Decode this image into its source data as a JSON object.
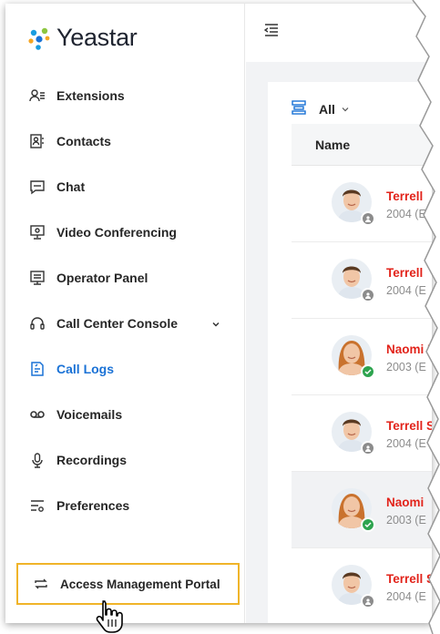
{
  "brand": {
    "name": "Yeastar",
    "colors": {
      "accent": "#1a72d6",
      "highlight": "#f0b429",
      "name_red": "#e2231a"
    }
  },
  "sidebar": {
    "items": [
      {
        "label": "Extensions",
        "icon": "extensions-icon"
      },
      {
        "label": "Contacts",
        "icon": "contacts-icon"
      },
      {
        "label": "Chat",
        "icon": "chat-icon"
      },
      {
        "label": "Video Conferencing",
        "icon": "video-conferencing-icon"
      },
      {
        "label": "Operator Panel",
        "icon": "operator-panel-icon"
      },
      {
        "label": "Call Center Console",
        "icon": "headset-icon"
      },
      {
        "label": "Call Logs",
        "icon": "call-logs-icon",
        "active": true
      },
      {
        "label": "Voicemails",
        "icon": "voicemail-icon"
      },
      {
        "label": "Recordings",
        "icon": "microphone-icon"
      },
      {
        "label": "Preferences",
        "icon": "preferences-icon"
      }
    ],
    "access_portal": "Access Management Portal"
  },
  "main": {
    "filter_label": "All",
    "columns": {
      "name": "Name"
    },
    "rows": [
      {
        "name": "Terrell",
        "sub": "2004 (E",
        "status": "offline"
      },
      {
        "name": "Terrell",
        "sub": "2004 (E",
        "status": "offline"
      },
      {
        "name": "Naomi Ni",
        "sub": "2003 (E",
        "status": "online"
      },
      {
        "name": "Terrell S",
        "sub": "2004 (E",
        "status": "offline"
      },
      {
        "name": "Naomi",
        "sub": "2003 (E",
        "status": "online"
      },
      {
        "name": "Terrell S",
        "sub": "2004 (E",
        "status": "offline"
      }
    ]
  }
}
